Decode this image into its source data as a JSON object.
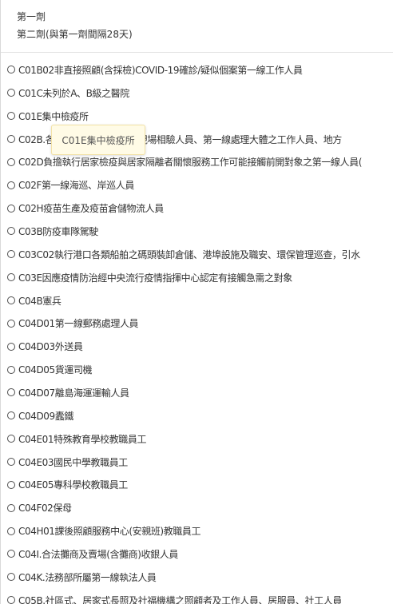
{
  "header": {
    "dose1": "第一劑",
    "dose2": "第二劑(與第一劑間隔28天)"
  },
  "tooltip": "C01E集中檢疫所",
  "options": [
    "C01B02非直接照顧(含採檢)COVID-19確診/疑似個案第一線工作人員",
    "C01C未列於A、B級之醫院",
    "C01E集中檢疫所",
    "C02B.各級政府衛生局人員、現場相驗人員、第一線處理大體之工作人員、地方",
    "C02D負擔執行居家檢疫與居家隔離者關懷服務工作可能接觸前開對象之第一線人員(",
    "C02F第一線海巡、岸巡人員",
    "C02H疫苗生產及疫苗倉儲物流人員",
    "C03B防疫車隊駕駛",
    "C03C02執行港口各類船舶之碼頭裝卸倉儲、港埠設施及職安、環保管理巡查，引水",
    "C03E因應疫情防治經中央流行疫情指揮中心認定有接觸急需之對象",
    "C04B憲兵",
    "C04D01第一線郵務處理人員",
    "C04D03外送員",
    "C04D05貨運司機",
    "C04D07離島海運運輸人員",
    "C04D09蠹鐵",
    "C04E01特殊教育學校教職員工",
    "C04E03國民中學教職員工",
    "C04E05專科學校教職員工",
    "C04F02保母",
    "C04H01課後照顧服務中心(安親班)教職員工",
    "C04I.合法攤商及賣場(含攤商)收銀人員",
    "C04K.法務部所屬第一線執法人員",
    "C05B.社區式、居家式長照及社福機構之照顧者及工作人員、居服員、社工人員"
  ]
}
